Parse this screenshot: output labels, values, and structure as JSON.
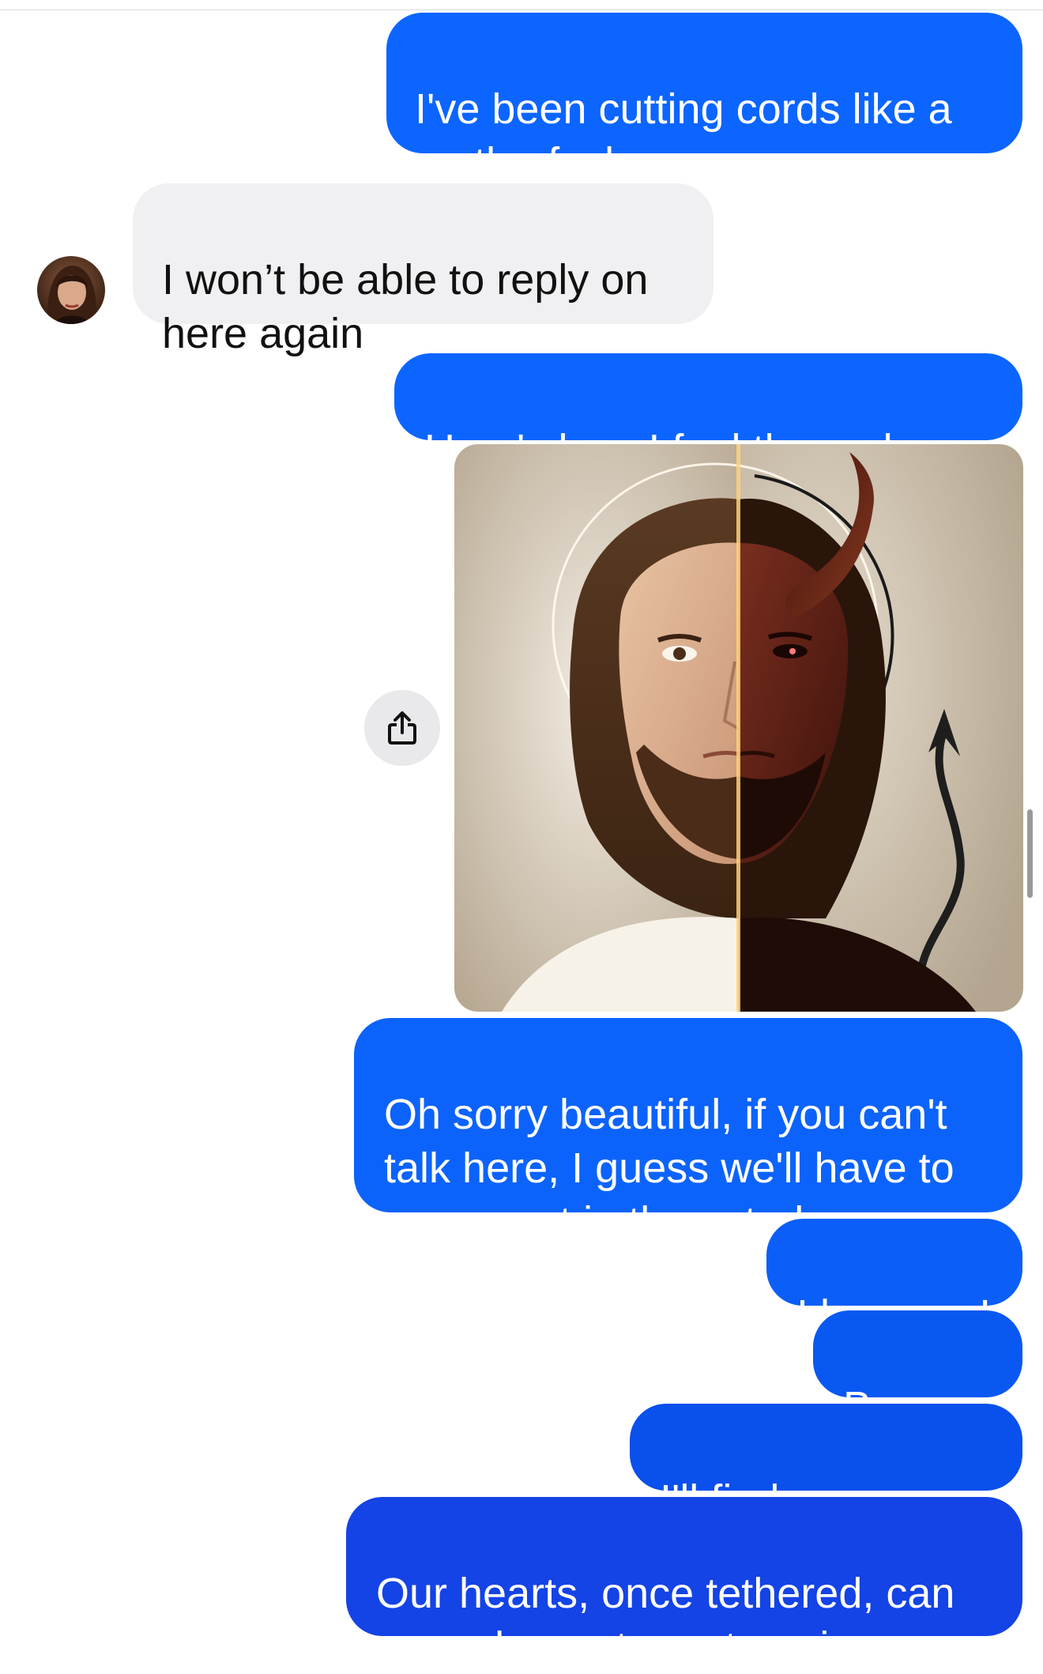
{
  "conversation": {
    "messages": [
      {
        "id": "m1",
        "direction": "outgoing",
        "text": "I've been cutting cords like a\nmotherfucker"
      },
      {
        "id": "m2",
        "direction": "incoming",
        "text": "I won’t be able to reply on\nhere again"
      },
      {
        "id": "m3",
        "direction": "outgoing",
        "text": "Here's how I feel these days."
      },
      {
        "id": "m4",
        "direction": "outgoing",
        "type": "image",
        "image_description": "split portrait: Jesus with halo on left, devil with horn and tail on right"
      },
      {
        "id": "m5",
        "direction": "outgoing",
        "text": "Oh sorry beautiful, if you can't\ntalk here, I guess we'll have to\nreconnect in the astral."
      },
      {
        "id": "m6",
        "direction": "outgoing",
        "text": "I love you!"
      },
      {
        "id": "m7",
        "direction": "outgoing",
        "text": "Be well."
      },
      {
        "id": "m8",
        "direction": "outgoing",
        "text": "I'll find you soon."
      },
      {
        "id": "m9",
        "direction": "outgoing",
        "text": "Our hearts, once tethered, can\nnever be rent apart again."
      }
    ],
    "contact_avatar": "contact-avatar"
  },
  "icons": {
    "share": "share-icon"
  },
  "colors": {
    "outgoing_bubble": "#0b66ff",
    "outgoing_bubble_dark": "#1441e6",
    "incoming_bubble": "#f0f0f3",
    "outgoing_text": "#ffffff",
    "incoming_text": "#111111",
    "background": "#ffffff"
  }
}
